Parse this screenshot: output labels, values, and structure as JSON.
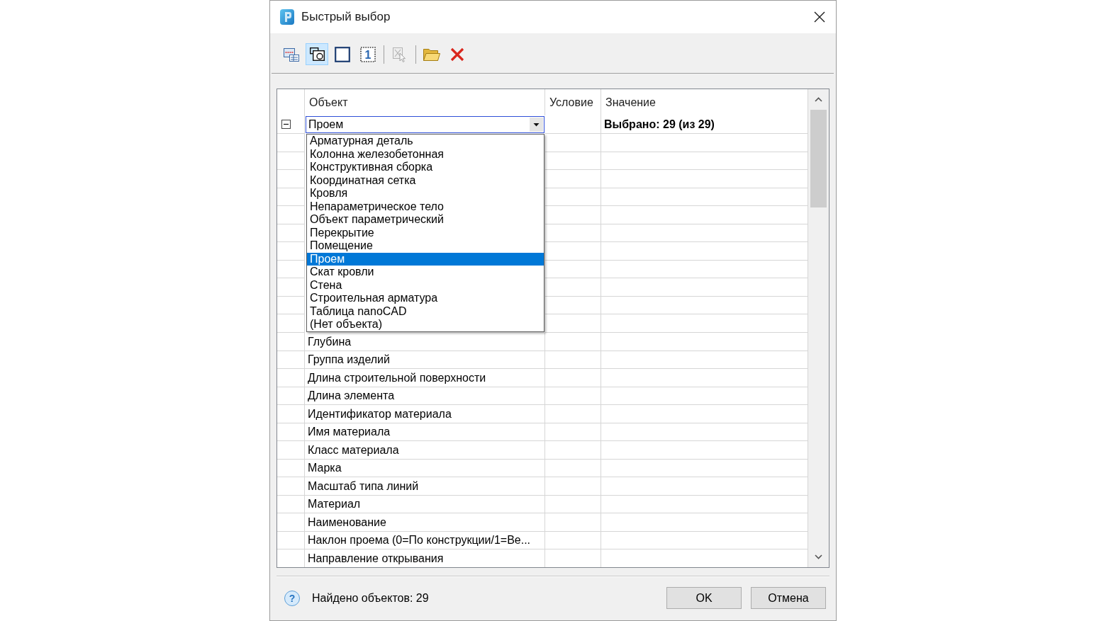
{
  "window": {
    "title": "Быстрый выбор"
  },
  "toolbar": {
    "groups": [
      [
        {
          "selected": false,
          "disabled": false
        },
        {
          "selected": true,
          "disabled": false
        },
        {
          "selected": false,
          "disabled": false
        },
        {
          "selected": false,
          "disabled": false,
          "glyph": "1"
        }
      ],
      [
        {
          "selected": false,
          "disabled": true
        }
      ],
      [
        {
          "selected": false,
          "disabled": false
        },
        {
          "selected": false,
          "disabled": false
        }
      ]
    ]
  },
  "grid": {
    "columns": [
      "Объект",
      "Условие",
      "Значение"
    ],
    "group": {
      "expanded": true,
      "object": "Проем",
      "open": true,
      "value": "Выбрано: 29 (из 29)"
    },
    "options": [
      {
        "label": "Арматурная деталь",
        "selected": false
      },
      {
        "label": "Колонна железобетонная",
        "selected": false
      },
      {
        "label": "Конструктивная сборка",
        "selected": false
      },
      {
        "label": "Координатная сетка",
        "selected": false
      },
      {
        "label": "Кровля",
        "selected": false
      },
      {
        "label": "Непараметрическое тело",
        "selected": false
      },
      {
        "label": "Объект параметрический",
        "selected": false
      },
      {
        "label": "Перекрытие",
        "selected": false
      },
      {
        "label": "Помещение",
        "selected": false
      },
      {
        "label": "Проем",
        "selected": true
      },
      {
        "label": "Скат кровли",
        "selected": false
      },
      {
        "label": "Стена",
        "selected": false
      },
      {
        "label": "Строительная арматура",
        "selected": false
      },
      {
        "label": "Таблица nanoCAD",
        "selected": false
      },
      {
        "label": "(Нет объекта)",
        "selected": false
      }
    ],
    "rows": [
      {
        "object": "Глубина"
      },
      {
        "object": "Группа изделий"
      },
      {
        "object": "Длина строительной поверхности"
      },
      {
        "object": "Длина элемента"
      },
      {
        "object": "Идентификатор материала"
      },
      {
        "object": "Имя материала"
      },
      {
        "object": "Класс материала"
      },
      {
        "object": "Марка"
      },
      {
        "object": "Масштаб типа линий"
      },
      {
        "object": "Материал"
      },
      {
        "object": "Наименование"
      },
      {
        "object": "Наклон проема (0=По конструкции/1=Ве..."
      },
      {
        "object": "Направление открывания"
      }
    ]
  },
  "status_bar": {
    "help_glyph": "?",
    "text": "Найдено объектов: 29"
  },
  "buttons": [
    "OK",
    "Отмена"
  ]
}
